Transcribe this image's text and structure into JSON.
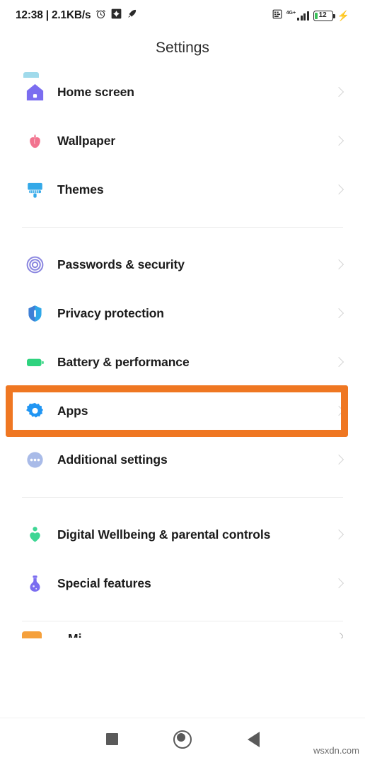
{
  "statusbar": {
    "clock": "12:38 | 2.1KB/s",
    "alarm_icon": "alarm-clock-icon",
    "square_icon": "app-badge-icon",
    "rocket_icon": "rocket-icon",
    "sim_icon": "sim-card-icon",
    "network_label": "4G+",
    "signal_icon": "signal-bars-icon",
    "battery_level": "12",
    "charging_icon": "charging-bolt-icon",
    "battery_fill_color": "#3ac05a"
  },
  "header": {
    "title": "Settings"
  },
  "highlight": {
    "color": "#ef7722",
    "target_row": "Apps"
  },
  "sections": [
    {
      "id": "personalization",
      "items": [
        {
          "label": "Home screen",
          "icon": "home-screen-icon",
          "color": "#7b6df0"
        },
        {
          "label": "Wallpaper",
          "icon": "wallpaper-flower-icon",
          "color": "#f2738f"
        },
        {
          "label": "Themes",
          "icon": "themes-brush-icon",
          "color": "#34a9e8"
        }
      ]
    },
    {
      "id": "system",
      "items": [
        {
          "label": "Passwords & security",
          "icon": "fingerprint-icon",
          "color": "#8b87e0"
        },
        {
          "label": "Privacy protection",
          "icon": "shield-icon",
          "color": "#2fa7e8"
        },
        {
          "label": "Battery & performance",
          "icon": "battery-icon",
          "color": "#2fd37f"
        },
        {
          "label": "Apps",
          "icon": "gear-icon",
          "color": "#2196f3"
        },
        {
          "label": "Additional settings",
          "icon": "more-dots-icon",
          "color": "#a9bbe8"
        }
      ]
    },
    {
      "id": "wellbeing",
      "items": [
        {
          "label": "Digital Wellbeing & parental controls",
          "icon": "wellbeing-heart-icon",
          "color": "#3ed694"
        },
        {
          "label": "Special features",
          "icon": "special-flask-icon",
          "color": "#7b6df0"
        }
      ]
    }
  ],
  "partial_bottom": {
    "label": "Mi ...",
    "icon": "mi-account-icon",
    "color": "#f5a03b"
  },
  "navbar": {
    "recents_label": "recents-square-icon",
    "home_label": "home-circle-icon",
    "back_label": "back-triangle-icon"
  },
  "watermark": {
    "text": "wsxdn.com"
  }
}
